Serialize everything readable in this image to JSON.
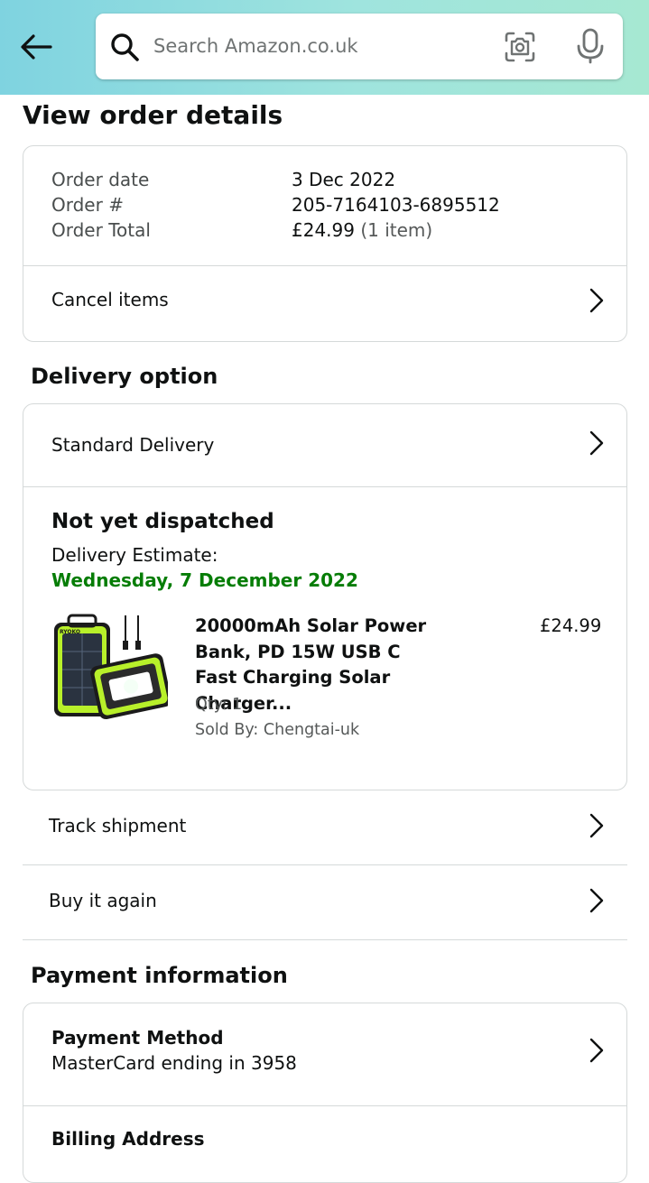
{
  "header": {
    "search_placeholder": "Search Amazon.co.uk",
    "icons": [
      "back-arrow-icon",
      "search-icon",
      "camera-icon",
      "microphone-icon"
    ],
    "gradient_colors": [
      "#7fd3e0",
      "#a6e8d2"
    ]
  },
  "page_title": "View order details",
  "order": {
    "date_label": "Order date",
    "date_value": "3 Dec 2022",
    "number_label": "Order #",
    "number_value": "205-7164103-6895512",
    "total_label": "Order Total",
    "total_value": "£24.99",
    "total_items": "(1 item)",
    "cancel_label": "Cancel items"
  },
  "delivery": {
    "section_title": "Delivery option",
    "option_label": "Standard Delivery",
    "status": "Not yet dispatched",
    "estimate_label": "Delivery Estimate:",
    "estimate_date": "Wednesday, 7 December 2022",
    "estimate_color": "#067d06"
  },
  "product": {
    "title": "20000mAh Solar Power Bank, PD 15W USB C Fast Charging Solar Charger...",
    "price": "£24.99",
    "qty": "Qty: 1",
    "sold_by": "Sold By: Chengtai-uk",
    "image_brand": "RYOKO"
  },
  "actions": {
    "track_label": "Track shipment",
    "buy_again_label": "Buy it again"
  },
  "payment": {
    "section_title": "Payment information",
    "method_title": "Payment Method",
    "method_value": "MasterCard ending in 3958",
    "billing_title": "Billing Address"
  }
}
